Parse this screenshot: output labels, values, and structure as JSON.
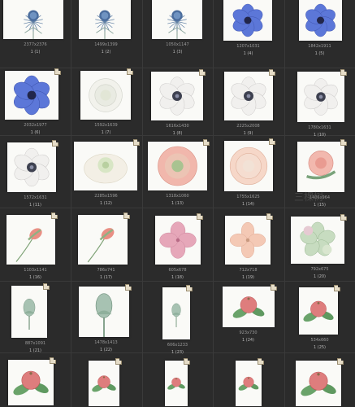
{
  "rows": [
    [
      {
        "dims": "2377x2376",
        "label": "1 (1)",
        "art": "thistle"
      },
      {
        "dims": "1499x1399",
        "label": "1 (2)",
        "art": "thistle"
      },
      {
        "dims": "1050x1147",
        "label": "1 (3)",
        "art": "thistle"
      },
      {
        "dims": "1207x1031",
        "label": "1 (4)",
        "art": "blue-anemone"
      },
      {
        "dims": "1842x1911",
        "label": "1 (5)",
        "art": "blue-anemone"
      }
    ],
    [
      {
        "dims": "2032x1977",
        "label": "1 (6)",
        "art": "blue-anemone"
      },
      {
        "dims": "1592x1639",
        "label": "1 (7)",
        "art": "white-rose"
      },
      {
        "dims": "1616x1430",
        "label": "1 (8)",
        "art": "white-anemone"
      },
      {
        "dims": "2225x2008",
        "label": "1 (9)",
        "art": "white-anemone"
      },
      {
        "dims": "1780x1631",
        "label": "1 (10)",
        "art": "white-anemone"
      }
    ],
    [
      {
        "dims": "1572x1631",
        "label": "1 (11)",
        "art": "white-anemone"
      },
      {
        "dims": "2285x1596",
        "label": "1 (12)",
        "art": "ranunculus-cream"
      },
      {
        "dims": "1318x1060",
        "label": "1 (13)",
        "art": "ranunculus-pink"
      },
      {
        "dims": "1755x1625",
        "label": "1 (14)",
        "art": "ranunculus-peach"
      },
      {
        "dims": "1406x964",
        "label": "1 (15)",
        "art": "rose-pink"
      }
    ],
    [
      {
        "dims": "1103x1141",
        "label": "1 (16)",
        "art": "bud-pink"
      },
      {
        "dims": "786x741",
        "label": "1 (17)",
        "art": "bud-pink"
      },
      {
        "dims": "605x678",
        "label": "1 (18)",
        "art": "hydrangea-pink"
      },
      {
        "dims": "712x718",
        "label": "1 (19)",
        "art": "hydrangea-peach"
      },
      {
        "dims": "792x675",
        "label": "1 (20)",
        "art": "hydrangea-green"
      }
    ],
    [
      {
        "dims": "887x1091",
        "label": "1 (21)",
        "art": "bud-green"
      },
      {
        "dims": "1478x1413",
        "label": "1 (22)",
        "art": "bud-green"
      },
      {
        "dims": "606x1233",
        "label": "1 (23)",
        "art": "bud-green"
      },
      {
        "dims": "923x730",
        "label": "1 (24)",
        "art": "berry"
      },
      {
        "dims": "534x660",
        "label": "1 (25)",
        "art": "berry"
      }
    ],
    [
      {
        "dims": "",
        "label": "",
        "art": "berry"
      },
      {
        "dims": "",
        "label": "",
        "art": "berry"
      },
      {
        "dims": "",
        "label": "",
        "art": "berry"
      },
      {
        "dims": "",
        "label": "",
        "art": "berry"
      },
      {
        "dims": "",
        "label": "",
        "art": "berry"
      }
    ]
  ],
  "watermark": "三棵树",
  "colors": {
    "background": "#2b2b2b",
    "thumb": "#fafaf7",
    "text": "#b8b8b8",
    "dims": "#9a9a9a"
  }
}
